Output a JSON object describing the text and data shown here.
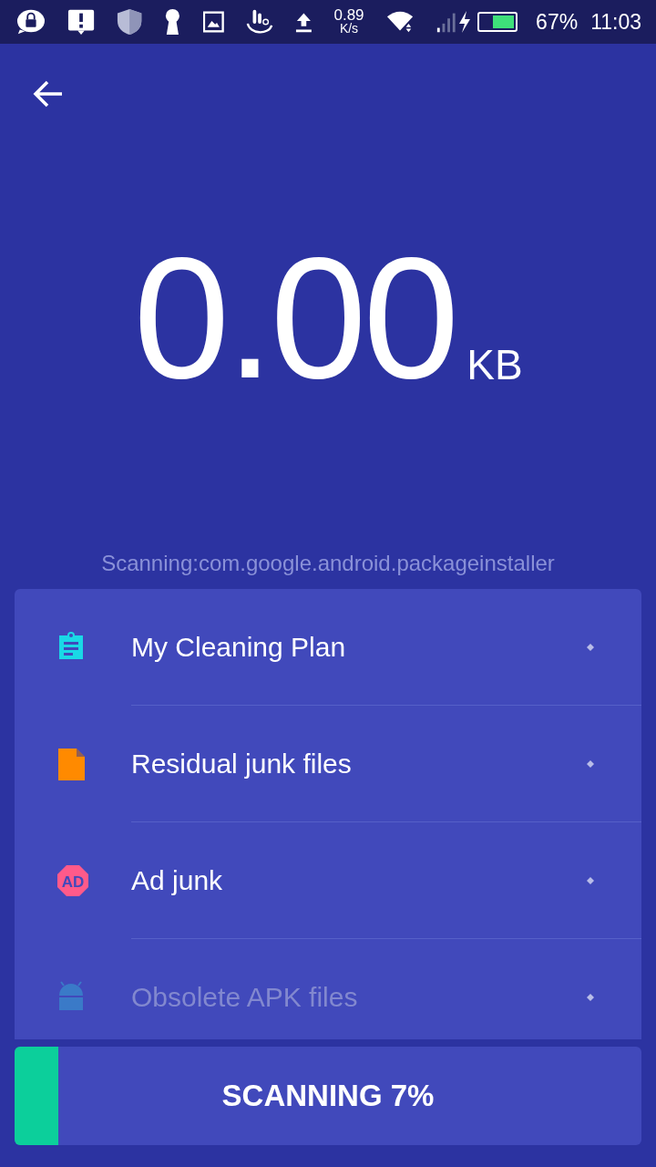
{
  "status_bar": {
    "speed": "0.89",
    "speed_unit": "K/s",
    "battery": "67%",
    "time": "11:03"
  },
  "size": {
    "value": "0.00",
    "unit": "KB"
  },
  "scanning_label": "Scanning:com.google.android.packageinstaller",
  "items": [
    {
      "kind": "clipboard",
      "label": "My Cleaning Plan",
      "color": "#1ad8e6"
    },
    {
      "kind": "file",
      "label": "Residual junk files",
      "color": "#ff8a00"
    },
    {
      "kind": "ad",
      "label": "Ad junk",
      "color": "#ff5a8a",
      "icon_text": "AD"
    },
    {
      "kind": "android",
      "label": "Obsolete APK files",
      "color": "#3a7ac8"
    }
  ],
  "scan_button": {
    "label": "SCANNING 7%",
    "level": 0.07
  }
}
